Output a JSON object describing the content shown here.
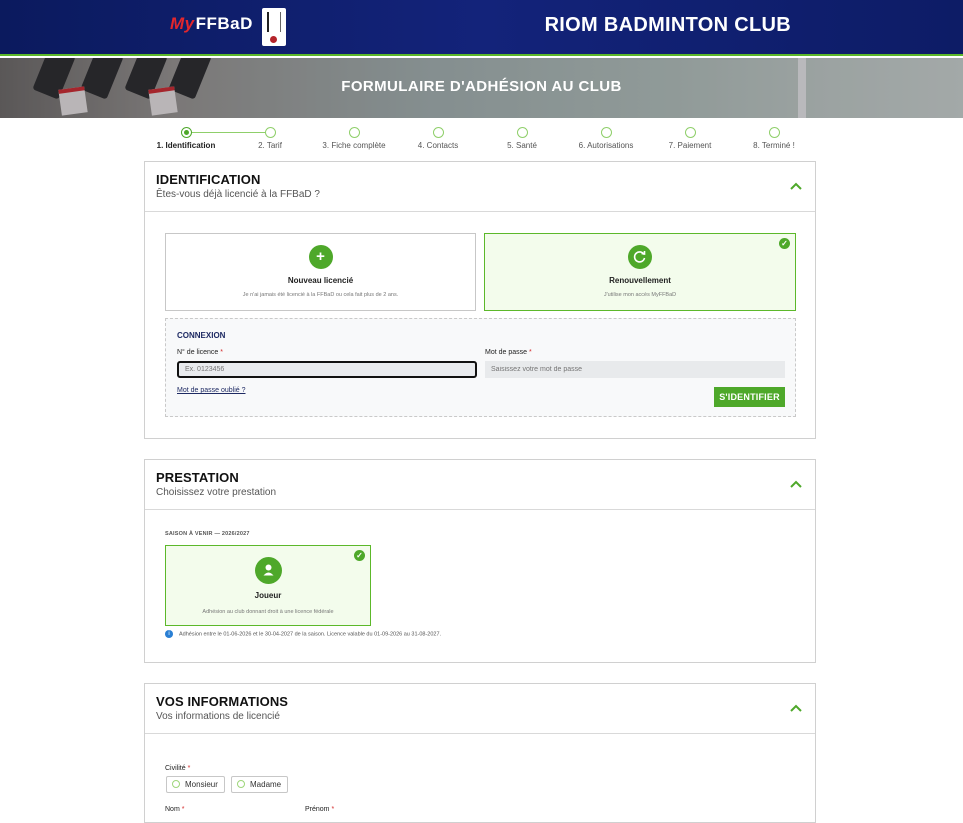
{
  "header": {
    "brand_my": "My",
    "brand_ffbad": "FFBaD",
    "club_title": "RIOM BADMINTON CLUB"
  },
  "hero": {
    "title": "FORMULAIRE D'ADHÉSION AU CLUB"
  },
  "steps": [
    {
      "label": "1. Identification",
      "active": true
    },
    {
      "label": "2. Tarif",
      "active": false
    },
    {
      "label": "3. Fiche complète",
      "active": false
    },
    {
      "label": "4. Contacts",
      "active": false
    },
    {
      "label": "5. Santé",
      "active": false
    },
    {
      "label": "6. Autorisations",
      "active": false
    },
    {
      "label": "7. Paiement",
      "active": false
    },
    {
      "label": "8. Terminé !",
      "active": false
    }
  ],
  "identification": {
    "title": "IDENTIFICATION",
    "subtitle": "Êtes-vous déjà licencié à la FFBaD ?",
    "new": {
      "icon": "+",
      "title": "Nouveau licencié",
      "desc": "Je n'ai jamais été licencié à la FFBaD ou cela fait plus de 2 ans."
    },
    "renew": {
      "title": "Renouvellement",
      "desc": "J'utilise mon accès MyFFBaD"
    },
    "check": "✓",
    "login": {
      "title": "CONNEXION",
      "license_label": "N° de licence",
      "license_placeholder": "Ex. 0123456",
      "password_label": "Mot de passe",
      "password_placeholder": "Saisissez votre mot de passe",
      "required_mark": "*",
      "forgot": "Mot de passe oublié ?",
      "submit": "S'IDENTIFIER"
    }
  },
  "prestation": {
    "title": "PRESTATION",
    "subtitle": "Choisissez votre prestation",
    "season": "SAISON À VENIR — 2026/2027",
    "player": {
      "title": "Joueur",
      "desc": "Adhésion au club donnant droit à une licence fédérale"
    },
    "check": "✓",
    "info_icon": "i",
    "info": "Adhésion entre le 01-06-2026 et le 30-04-2027 de la saison. Licence valable du 01-09-2026 au 31-08-2027."
  },
  "informations": {
    "title": "VOS INFORMATIONS",
    "subtitle": "Vos informations de licencié",
    "civility_label": "Civilité",
    "required_mark": "*",
    "monsieur": "Monsieur",
    "madame": "Madame",
    "nom_label": "Nom",
    "prenom_label": "Prénom"
  },
  "colors": {
    "navy": "#13237a",
    "green": "#4ea82a",
    "required": "#d42a2a"
  }
}
